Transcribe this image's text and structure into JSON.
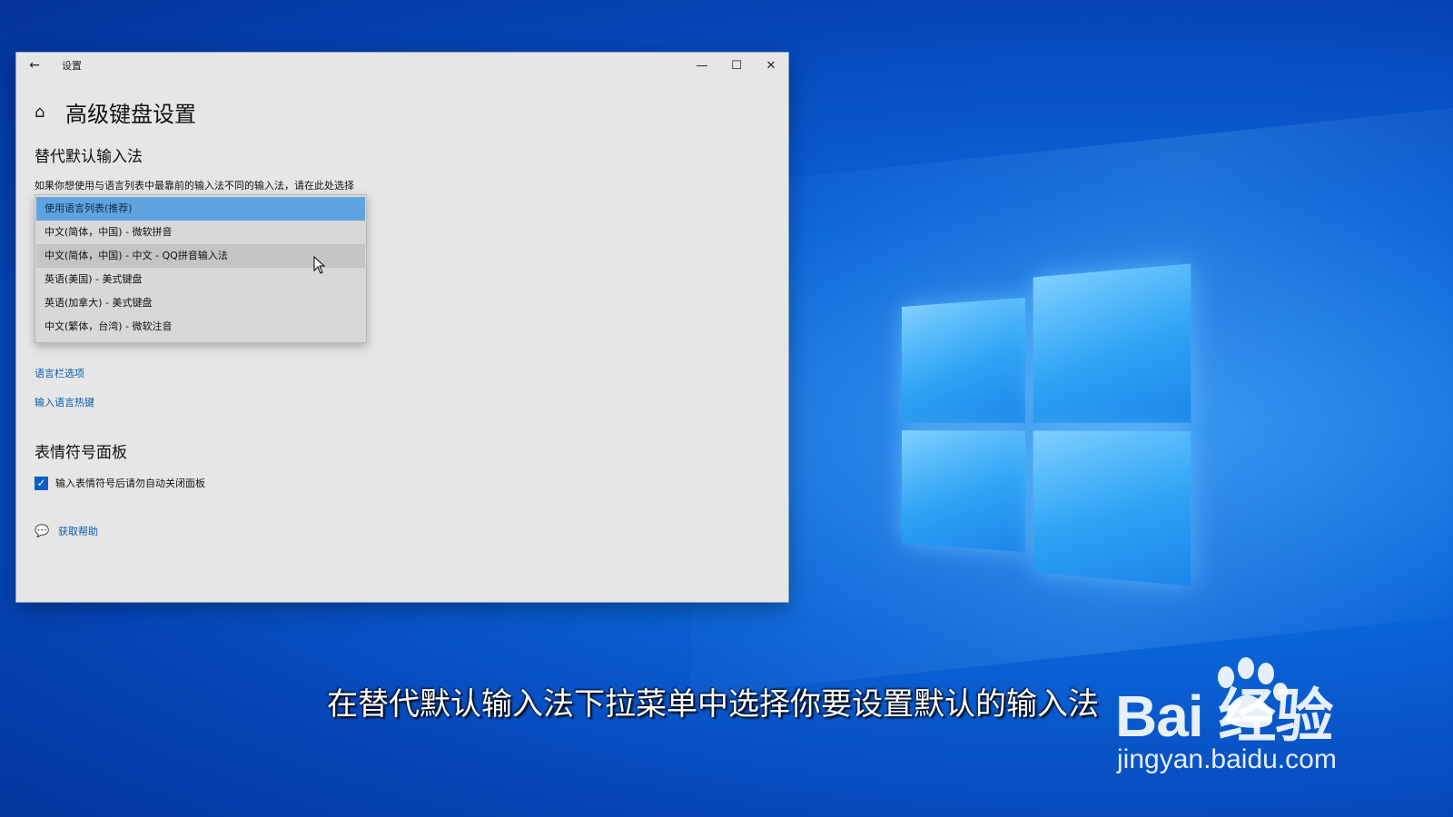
{
  "window": {
    "title": "设置",
    "page_title": "高级键盘设置",
    "controls": {
      "minimize": "—",
      "maximize": "☐",
      "close": "✕"
    }
  },
  "section_ime": {
    "heading": "替代默认输入法",
    "description": "如果你想使用与语言列表中最靠前的输入法不同的输入法，请在此处选择",
    "dropdown_options": [
      "使用语言列表(推荐)",
      "中文(简体，中国) - 微软拼音",
      "中文(简体，中国) - 中文 - QQ拼音输入法",
      "英语(美国) - 美式键盘",
      "英语(加拿大) - 美式键盘",
      "中文(繁体，台湾) - 微软注音"
    ],
    "selected_index": 0,
    "hover_index": 2
  },
  "links": {
    "language_bar": "语言栏选项",
    "hotkeys": "输入语言热键"
  },
  "section_emoji": {
    "heading": "表情符号面板",
    "checkbox_label": "输入表情符号后请勿自动关闭面板",
    "checked": true
  },
  "help": {
    "label": "获取帮助",
    "icon": "chat-help-icon"
  },
  "caption": "在替代默认输入法下拉菜单中选择你要设置默认的输入法",
  "watermark": {
    "brand": "Bai  经验",
    "url": "jingyan.baidu.com"
  },
  "colors": {
    "accent": "#0a5fc7",
    "link": "#0b5cab",
    "selected": "#5fa4e0",
    "window_bg": "#e6e6e6"
  }
}
